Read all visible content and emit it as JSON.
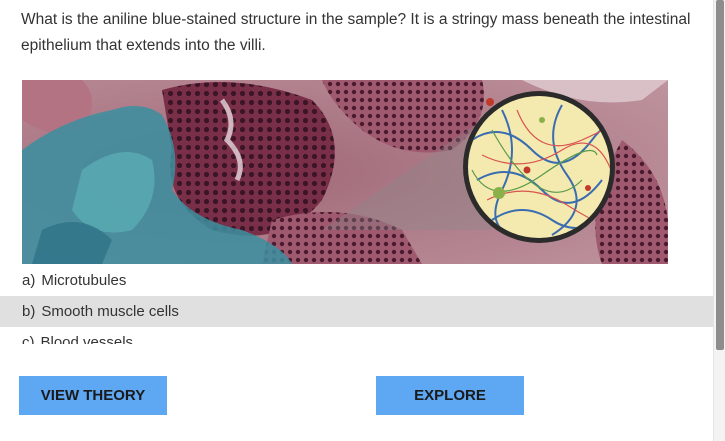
{
  "question": {
    "text": "What is the aniline blue-stained structure in the sample? It is a stringy mass beneath the intestinal epithelium that extends into the villi."
  },
  "image": {
    "icon": "micrograph-image",
    "magnifier_icon": "magnifier-inset-icon"
  },
  "options": [
    {
      "letter": "a)",
      "label": "Microtubules",
      "selected": false
    },
    {
      "letter": "b)",
      "label": "Smooth muscle cells",
      "selected": true
    },
    {
      "letter": "c)",
      "label": "Blood vessels",
      "selected": false
    }
  ],
  "buttons": {
    "view_theory": "VIEW THEORY",
    "explore": "EXPLORE"
  },
  "colors": {
    "button_bg": "#5ea7f2",
    "selected_bg": "#e0e0e0",
    "stain_blue": "#3a8fa0",
    "tissue_purple": "#6b2a3f"
  }
}
